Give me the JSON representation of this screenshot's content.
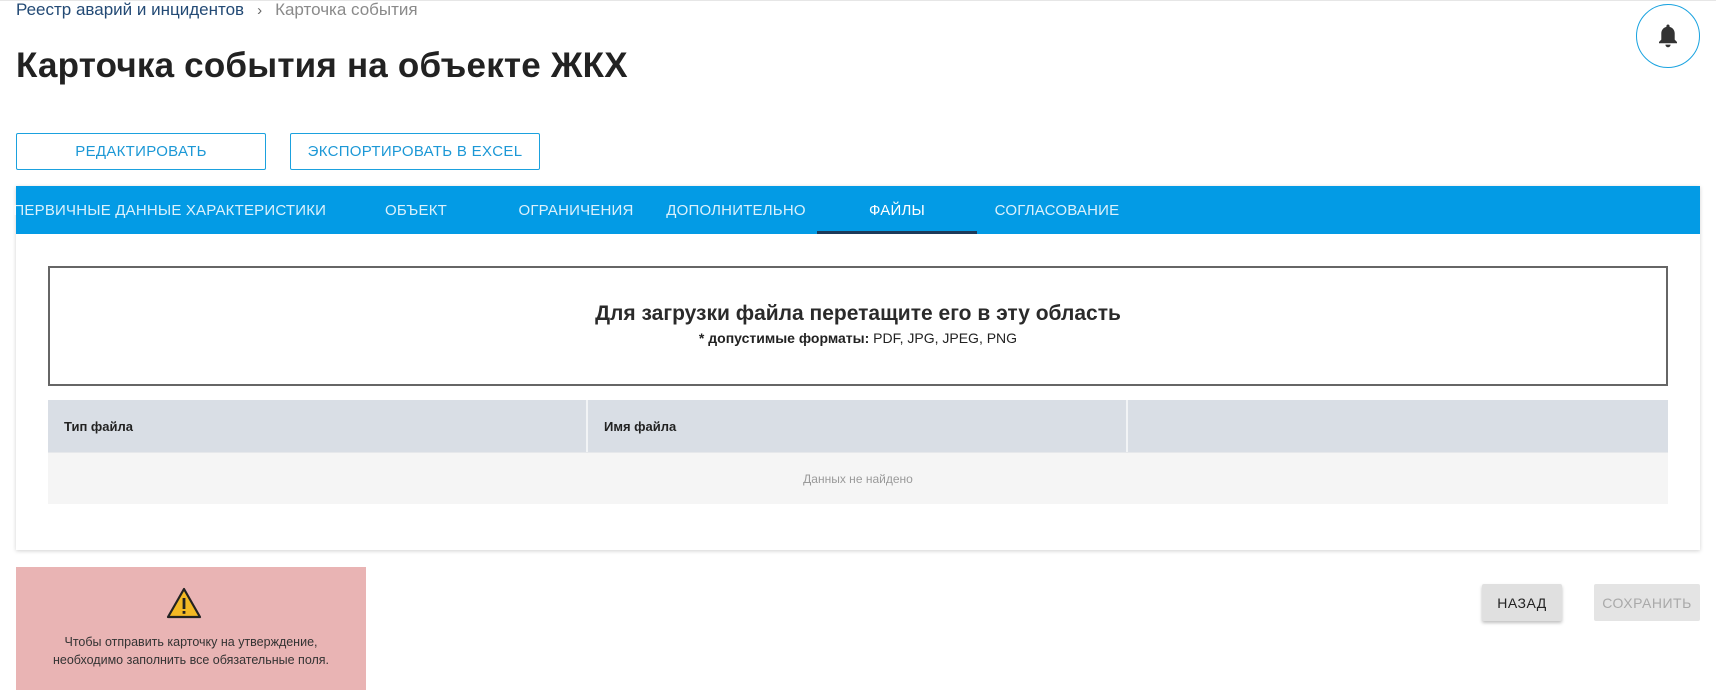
{
  "breadcrumb": {
    "parent": "Реестр аварий и инцидентов",
    "separator": "›",
    "current": "Карточка события"
  },
  "header": {
    "title": "Карточка события на объекте ЖКХ",
    "notifications_icon": "bell-icon"
  },
  "actions": {
    "edit_label": "РЕДАКТИРОВАТЬ",
    "export_label": "ЭКСПОРТИРОВАТЬ В EXCEL"
  },
  "tabs": [
    {
      "label": "ПЕРВИЧНЫЕ ДАННЫЕ",
      "active": false
    },
    {
      "label": "ХАРАКТЕРИСТИКИ",
      "active": false
    },
    {
      "label": "ОБЪЕКТ",
      "active": false
    },
    {
      "label": "ОГРАНИЧЕНИЯ",
      "active": false
    },
    {
      "label": "ДОПОЛНИТЕЛЬНО",
      "active": false
    },
    {
      "label": "ФАЙЛЫ",
      "active": true
    },
    {
      "label": "СОГЛАСОВАНИЕ",
      "active": false
    }
  ],
  "dropzone": {
    "title": "Для загрузки файла перетащите его в эту область",
    "hint_prefix": "* допустимые форматы:",
    "hint_formats": "PDF, JPG, JPEG, PNG"
  },
  "files_table": {
    "columns": [
      "Тип файла",
      "Имя файла",
      ""
    ],
    "empty_text": "Данных не найдено"
  },
  "warning": {
    "icon": "warning-triangle-icon",
    "line1": "Чтобы отправить карточку на утверждение,",
    "line2": "необходимо заполнить все обязательные поля."
  },
  "footer": {
    "back_label": "НАЗАД",
    "save_label": "СОХРАНИТЬ",
    "save_disabled": true
  },
  "colors": {
    "accent": "#039be5",
    "tab_indicator": "#1d3a5a",
    "warning_bg": "#e9b4b4",
    "warning_icon": "#f2b824"
  }
}
